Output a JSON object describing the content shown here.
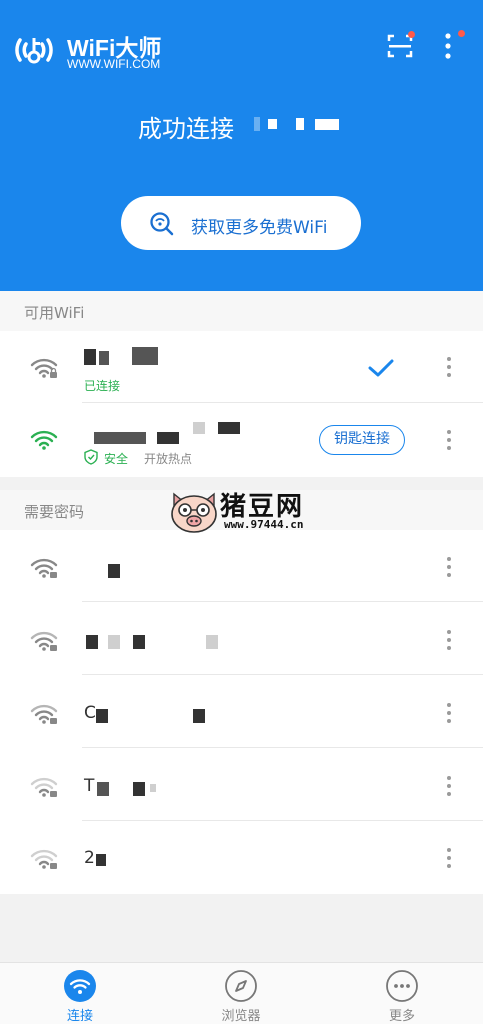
{
  "header": {
    "app_name": "WiFi大师",
    "app_url": "WWW.WIFI.COM",
    "status_text": "成功连接",
    "cta_label": "获取更多免费WiFi",
    "accent_color": "#1a86ec"
  },
  "available": {
    "title": "可用WiFi",
    "networks": [
      {
        "ssid": "",
        "status": "已连接",
        "connected": true
      },
      {
        "ssid": "",
        "security": "安全",
        "tag": "开放热点",
        "action_label": "钥匙连接"
      }
    ]
  },
  "password_required": {
    "title": "需要密码",
    "networks": [
      {
        "ssid": ""
      },
      {
        "ssid": ""
      },
      {
        "ssid": "C"
      },
      {
        "ssid": "T"
      },
      {
        "ssid": "2"
      }
    ]
  },
  "watermark": {
    "title": "猪豆网",
    "url": "www.97444.cn"
  },
  "nav": {
    "items": [
      {
        "label": "连接",
        "icon": "wifi-icon",
        "active": true
      },
      {
        "label": "浏览器",
        "icon": "compass-icon",
        "active": false
      },
      {
        "label": "更多",
        "icon": "more-dots-icon",
        "active": false
      }
    ]
  }
}
